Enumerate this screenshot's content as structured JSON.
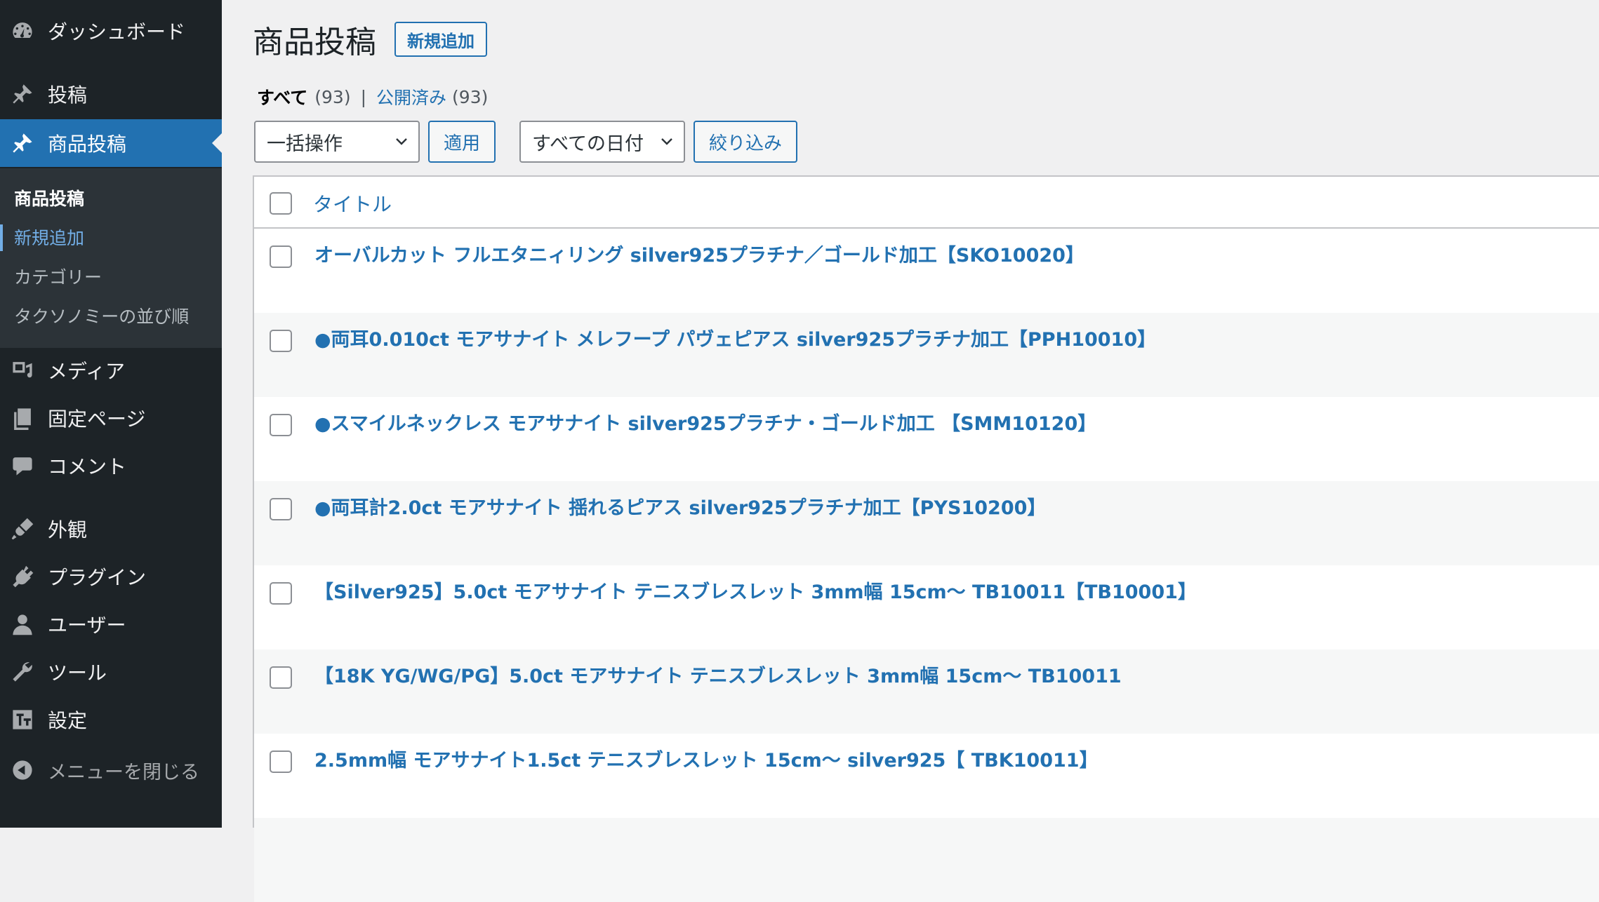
{
  "sidebar": {
    "items": [
      {
        "label": "ダッシュボード",
        "icon": "dashboard-icon"
      },
      {
        "label": "投稿",
        "icon": "pin-icon"
      },
      {
        "label": "商品投稿",
        "icon": "pin-icon",
        "active": true
      },
      {
        "label": "メディア",
        "icon": "media-icon"
      },
      {
        "label": "固定ページ",
        "icon": "pages-icon"
      },
      {
        "label": "コメント",
        "icon": "comment-icon"
      },
      {
        "label": "外観",
        "icon": "appearance-icon"
      },
      {
        "label": "プラグイン",
        "icon": "plugin-icon"
      },
      {
        "label": "ユーザー",
        "icon": "user-icon"
      },
      {
        "label": "ツール",
        "icon": "wrench-icon"
      },
      {
        "label": "設定",
        "icon": "settings-icon"
      }
    ],
    "submenu": [
      "商品投稿",
      "新規追加",
      "カテゴリー",
      "タクソノミーの並び順"
    ],
    "collapse_label": "メニューを閉じる"
  },
  "header": {
    "title": "商品投稿",
    "add_new": "新規追加"
  },
  "filters": {
    "all_label": "すべて",
    "all_count": "(93)",
    "separator": "|",
    "published_label": "公開済み",
    "published_count": "(93)",
    "bulk_action": "一括操作",
    "apply": "適用",
    "date_filter": "すべての日付",
    "filter_button": "絞り込み"
  },
  "table": {
    "column_title": "タイトル",
    "rows": [
      "オーバルカット フルエタニィリング silver925プラチナ／ゴールド加工【SKO10020】",
      "●両耳0.010ct モアサナイト メレフープ パヴェピアス silver925プラチナ加工【PPH10010】",
      "●スマイルネックレス モアサナイト silver925プラチナ・ゴールド加工 【SMM10120】",
      "●両耳計2.0ct モアサナイト 揺れるピアス silver925プラチナ加工【PYS10200】",
      "【Silver925】5.0ct モアサナイト テニスブレスレット 3mm幅 15cm〜 TB10011【TB10001】",
      "【18K YG/WG/PG】5.0ct モアサナイト テニスブレスレット 3mm幅 15cm〜 TB10011",
      "2.5mm幅 モアサナイト1.5ct テニスブレスレット 15cm〜 silver925【 TBK10011】"
    ]
  },
  "colors": {
    "sidebar_bg": "#1d2327",
    "accent": "#2271b1",
    "submenu_bg": "#2c3338"
  }
}
